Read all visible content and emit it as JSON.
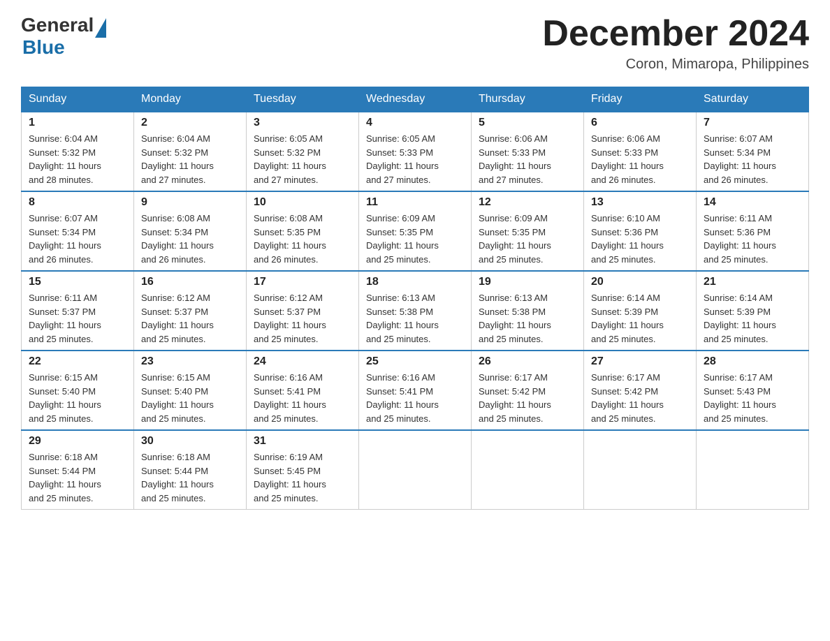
{
  "logo": {
    "general": "General",
    "blue": "Blue"
  },
  "title": "December 2024",
  "location": "Coron, Mimaropa, Philippines",
  "days_of_week": [
    "Sunday",
    "Monday",
    "Tuesday",
    "Wednesday",
    "Thursday",
    "Friday",
    "Saturday"
  ],
  "weeks": [
    [
      {
        "day": "1",
        "sunrise": "6:04 AM",
        "sunset": "5:32 PM",
        "daylight": "11 hours and 28 minutes."
      },
      {
        "day": "2",
        "sunrise": "6:04 AM",
        "sunset": "5:32 PM",
        "daylight": "11 hours and 27 minutes."
      },
      {
        "day": "3",
        "sunrise": "6:05 AM",
        "sunset": "5:32 PM",
        "daylight": "11 hours and 27 minutes."
      },
      {
        "day": "4",
        "sunrise": "6:05 AM",
        "sunset": "5:33 PM",
        "daylight": "11 hours and 27 minutes."
      },
      {
        "day": "5",
        "sunrise": "6:06 AM",
        "sunset": "5:33 PM",
        "daylight": "11 hours and 27 minutes."
      },
      {
        "day": "6",
        "sunrise": "6:06 AM",
        "sunset": "5:33 PM",
        "daylight": "11 hours and 26 minutes."
      },
      {
        "day": "7",
        "sunrise": "6:07 AM",
        "sunset": "5:34 PM",
        "daylight": "11 hours and 26 minutes."
      }
    ],
    [
      {
        "day": "8",
        "sunrise": "6:07 AM",
        "sunset": "5:34 PM",
        "daylight": "11 hours and 26 minutes."
      },
      {
        "day": "9",
        "sunrise": "6:08 AM",
        "sunset": "5:34 PM",
        "daylight": "11 hours and 26 minutes."
      },
      {
        "day": "10",
        "sunrise": "6:08 AM",
        "sunset": "5:35 PM",
        "daylight": "11 hours and 26 minutes."
      },
      {
        "day": "11",
        "sunrise": "6:09 AM",
        "sunset": "5:35 PM",
        "daylight": "11 hours and 25 minutes."
      },
      {
        "day": "12",
        "sunrise": "6:09 AM",
        "sunset": "5:35 PM",
        "daylight": "11 hours and 25 minutes."
      },
      {
        "day": "13",
        "sunrise": "6:10 AM",
        "sunset": "5:36 PM",
        "daylight": "11 hours and 25 minutes."
      },
      {
        "day": "14",
        "sunrise": "6:11 AM",
        "sunset": "5:36 PM",
        "daylight": "11 hours and 25 minutes."
      }
    ],
    [
      {
        "day": "15",
        "sunrise": "6:11 AM",
        "sunset": "5:37 PM",
        "daylight": "11 hours and 25 minutes."
      },
      {
        "day": "16",
        "sunrise": "6:12 AM",
        "sunset": "5:37 PM",
        "daylight": "11 hours and 25 minutes."
      },
      {
        "day": "17",
        "sunrise": "6:12 AM",
        "sunset": "5:37 PM",
        "daylight": "11 hours and 25 minutes."
      },
      {
        "day": "18",
        "sunrise": "6:13 AM",
        "sunset": "5:38 PM",
        "daylight": "11 hours and 25 minutes."
      },
      {
        "day": "19",
        "sunrise": "6:13 AM",
        "sunset": "5:38 PM",
        "daylight": "11 hours and 25 minutes."
      },
      {
        "day": "20",
        "sunrise": "6:14 AM",
        "sunset": "5:39 PM",
        "daylight": "11 hours and 25 minutes."
      },
      {
        "day": "21",
        "sunrise": "6:14 AM",
        "sunset": "5:39 PM",
        "daylight": "11 hours and 25 minutes."
      }
    ],
    [
      {
        "day": "22",
        "sunrise": "6:15 AM",
        "sunset": "5:40 PM",
        "daylight": "11 hours and 25 minutes."
      },
      {
        "day": "23",
        "sunrise": "6:15 AM",
        "sunset": "5:40 PM",
        "daylight": "11 hours and 25 minutes."
      },
      {
        "day": "24",
        "sunrise": "6:16 AM",
        "sunset": "5:41 PM",
        "daylight": "11 hours and 25 minutes."
      },
      {
        "day": "25",
        "sunrise": "6:16 AM",
        "sunset": "5:41 PM",
        "daylight": "11 hours and 25 minutes."
      },
      {
        "day": "26",
        "sunrise": "6:17 AM",
        "sunset": "5:42 PM",
        "daylight": "11 hours and 25 minutes."
      },
      {
        "day": "27",
        "sunrise": "6:17 AM",
        "sunset": "5:42 PM",
        "daylight": "11 hours and 25 minutes."
      },
      {
        "day": "28",
        "sunrise": "6:17 AM",
        "sunset": "5:43 PM",
        "daylight": "11 hours and 25 minutes."
      }
    ],
    [
      {
        "day": "29",
        "sunrise": "6:18 AM",
        "sunset": "5:44 PM",
        "daylight": "11 hours and 25 minutes."
      },
      {
        "day": "30",
        "sunrise": "6:18 AM",
        "sunset": "5:44 PM",
        "daylight": "11 hours and 25 minutes."
      },
      {
        "day": "31",
        "sunrise": "6:19 AM",
        "sunset": "5:45 PM",
        "daylight": "11 hours and 25 minutes."
      },
      null,
      null,
      null,
      null
    ]
  ],
  "labels": {
    "sunrise": "Sunrise:",
    "sunset": "Sunset:",
    "daylight": "Daylight:"
  }
}
